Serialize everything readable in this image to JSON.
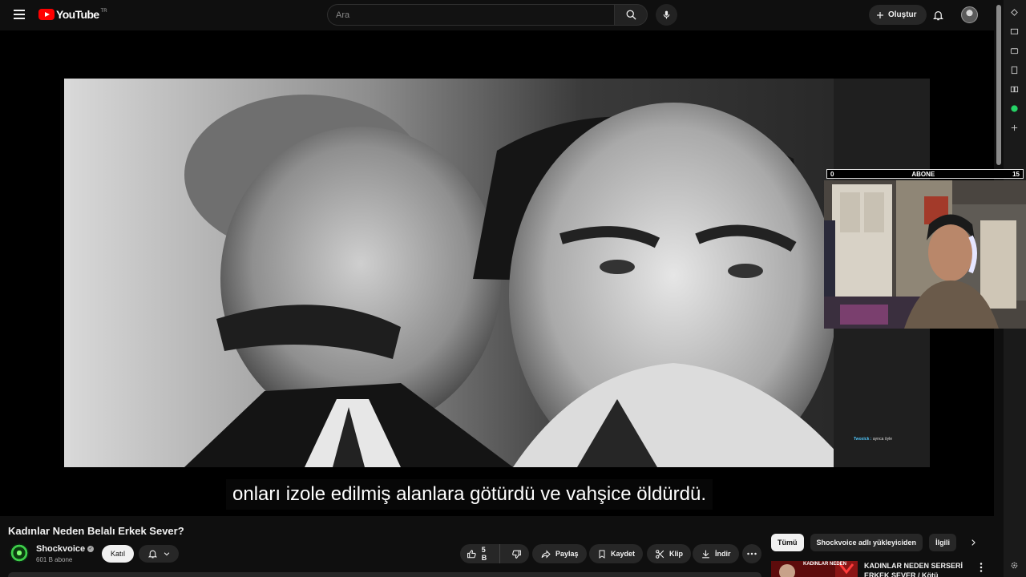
{
  "header": {
    "logo_text": "YouTube",
    "region_code": "TR",
    "search_placeholder": "Ara",
    "create_label": "Oluştur"
  },
  "player": {
    "caption": "onları izole edilmiş alanlara götürdü ve vahşice öldürdü.",
    "overlay": {
      "left_count": "0",
      "label": "ABONE",
      "right_count": "15"
    },
    "chat": {
      "user": "Twoxick :",
      "message": "ayrıca öyle"
    }
  },
  "video": {
    "title": "Kadınlar Neden Belalı Erkek Sever?",
    "channel_name": "Shockvoice",
    "subscribers": "601 B abone",
    "join_label": "Katıl",
    "like_count": "5 B",
    "share_label": "Paylaş",
    "save_label": "Kaydet",
    "clip_label": "Klip",
    "download_label": "İndir"
  },
  "sidebar": {
    "chips": [
      "Tümü",
      "Shockvoice adlı yükleyiciden",
      "İlgili"
    ],
    "recommendation": {
      "title": "KADINLAR NEDEN SERSERİ ERKEK SEVER / Kötü Çocuklar",
      "thumb_text": "KADINLAR NEDEN"
    }
  },
  "colors": {
    "background": "#0f0f0f",
    "brand_red": "#ff0000",
    "pill": "#272727",
    "text": "#f1f1f1",
    "secondary_text": "#aaaaaa"
  },
  "icons": [
    "menu-icon",
    "search-icon",
    "mic-icon",
    "plus-icon",
    "bell-icon",
    "verified-icon",
    "chevron-down-icon",
    "thumbs-up-icon",
    "thumbs-down-icon",
    "share-icon",
    "bookmark-icon",
    "scissors-icon",
    "download-icon",
    "more-horizontal-icon",
    "chevron-right-icon",
    "more-vertical-icon",
    "whatsapp-icon",
    "settings-icon"
  ]
}
